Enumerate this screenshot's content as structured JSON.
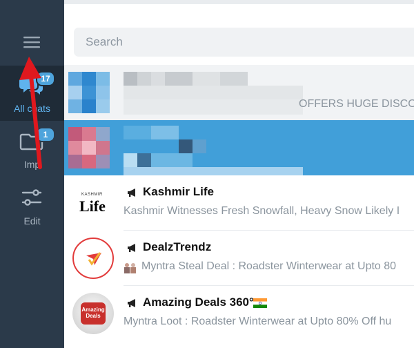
{
  "sidebar": {
    "folders": [
      {
        "label": "All chats",
        "badge": "17"
      },
      {
        "label": "Imp",
        "badge": "1"
      },
      {
        "label": "Edit"
      }
    ]
  },
  "search": {
    "placeholder": "Search"
  },
  "chats": [
    {
      "title": "",
      "preview": "OFFERS HUGE DISCOU",
      "redacted": true
    },
    {
      "title": "",
      "preview": "",
      "redacted": true,
      "selected": true
    },
    {
      "title": "Kashmir Life",
      "preview": "Kashmir Witnesses Fresh Snowfall, Heavy Snow Likely I",
      "avatar_text": "Life",
      "avatar_small": "KASHMIR"
    },
    {
      "title": "DealzTrendz",
      "preview": "Myntra Steal Deal : Roadster Winterwear at Upto 80",
      "avatar_color": "#e23b3b"
    },
    {
      "title": "Amazing Deals 360°",
      "preview": "Myntra Loot : Roadster Winterwear at Upto 80% Off  hu",
      "avatar_text": "Amazing Deals"
    }
  ],
  "colors": {
    "sidebar": "#2b3a4a",
    "sidebar_active": "#1f2b37",
    "accent": "#4ea4dc",
    "selected_row": "#419fd9",
    "arrow": "#e0181e"
  }
}
